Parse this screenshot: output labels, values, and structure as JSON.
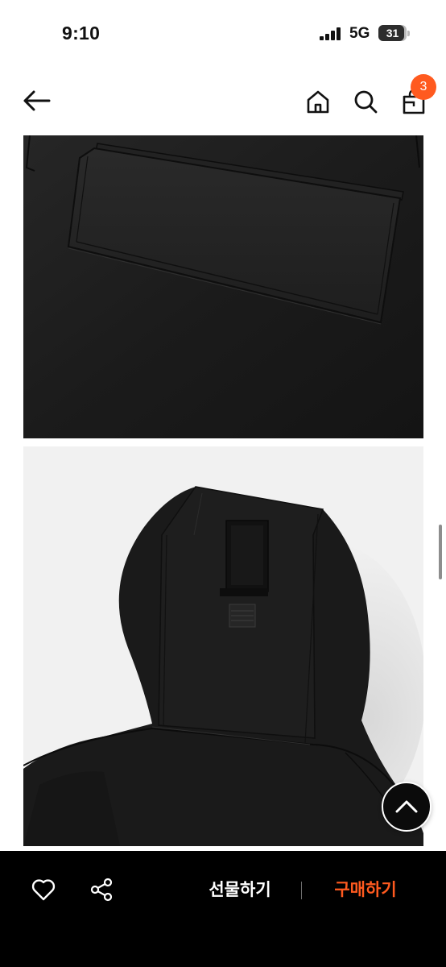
{
  "status_bar": {
    "time": "9:10",
    "network": "5G",
    "battery": "31",
    "icons": [
      "signal-icon",
      "battery-icon"
    ]
  },
  "header": {
    "icons": [
      "back-arrow-icon",
      "home-icon",
      "search-icon",
      "shopping-bag-icon"
    ],
    "cart_count": "3",
    "badge_color": "#ff5a1f"
  },
  "product_images": [
    {
      "name": "jacket-pocket-detail"
    },
    {
      "name": "jacket-hood-detail"
    }
  ],
  "floating": {
    "icon": "chevron-up-icon"
  },
  "bottom_bar": {
    "icons": [
      "heart-icon",
      "share-icon"
    ],
    "gift_label": "선물하기",
    "buy_label": "구매하기",
    "accent_color": "#ff5a1f",
    "background": "#000000"
  }
}
